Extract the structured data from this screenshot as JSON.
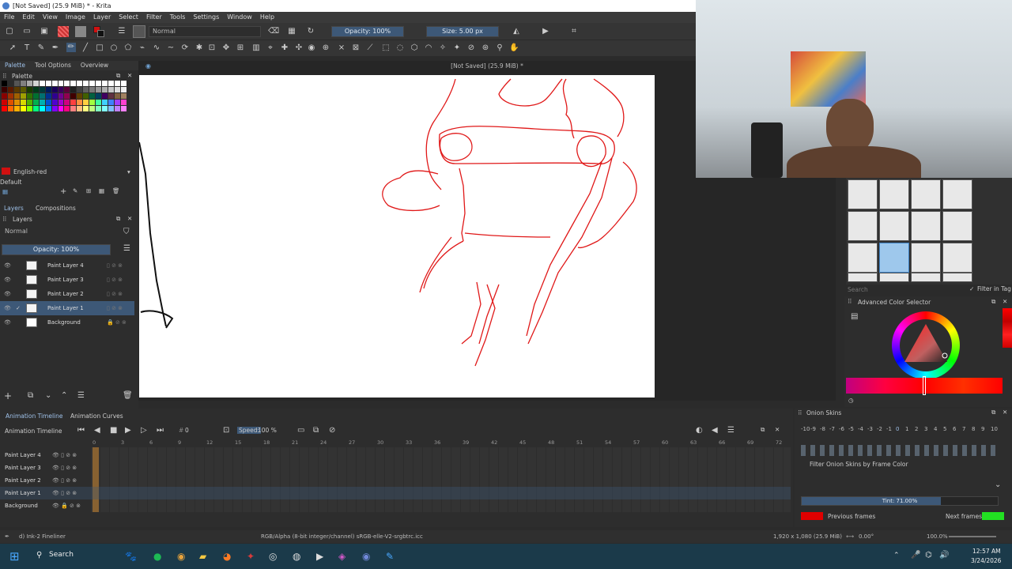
{
  "titlebar": {
    "title": "[Not Saved]  (25.9 MiB) * - Krita"
  },
  "menu": [
    "File",
    "Edit",
    "View",
    "Image",
    "Layer",
    "Select",
    "Filter",
    "Tools",
    "Settings",
    "Window",
    "Help"
  ],
  "toolbar": {
    "blend_mode": "Normal",
    "opacity": "Opacity: 100%",
    "size": "Size: 5.00 px"
  },
  "docker_tabs": [
    "Palette",
    "Tool Options",
    "Overview"
  ],
  "palette": {
    "title": "Palette",
    "current_color_name": "English-red",
    "palette_name": "Default",
    "colors": [
      "#000000",
      "#2b2b2b",
      "#555555",
      "#808080",
      "#aaaaaa",
      "#d4d4d4",
      "#ffffff",
      "#ffffff",
      "#ffffff",
      "#ffffff",
      "#ffffff",
      "#ffffff",
      "#ffffff",
      "#ffffff",
      "#ffffff",
      "#ffffff",
      "#ffffff",
      "#ffffff",
      "#ffffff",
      "#ffffff",
      "#3a0000",
      "#5a1a00",
      "#5a3a00",
      "#5a5a00",
      "#1a3a00",
      "#003a1a",
      "#003a3a",
      "#001a5a",
      "#1a005a",
      "#3a005a",
      "#5a003a",
      "#202020",
      "#404040",
      "#606060",
      "#7a7a7a",
      "#999999",
      "#b0b0b0",
      "#c8c8c8",
      "#dedede",
      "#f0f0f0",
      "#8a0000",
      "#a03000",
      "#a06000",
      "#a0a000",
      "#307000",
      "#007030",
      "#007070",
      "#003090",
      "#300090",
      "#700090",
      "#900050",
      "#400000",
      "#604000",
      "#406000",
      "#006040",
      "#004060",
      "#400060",
      "#603040",
      "#806040",
      "#a08060",
      "#d00000",
      "#e05000",
      "#e09000",
      "#d8d800",
      "#50b000",
      "#00b050",
      "#00b0b0",
      "#0050d0",
      "#5000d0",
      "#a000d0",
      "#d00080",
      "#ff4040",
      "#ff9040",
      "#ffd040",
      "#a0ff40",
      "#40ffa0",
      "#40d0ff",
      "#4080ff",
      "#a040ff",
      "#ff40d0",
      "#ff0000",
      "#ff6a00",
      "#ffb000",
      "#ffff00",
      "#80ff00",
      "#00ff80",
      "#00ffff",
      "#0080ff",
      "#8000ff",
      "#ff00ff",
      "#ff0080",
      "#ff8080",
      "#ffc080",
      "#ffff80",
      "#c0ff80",
      "#80ffc0",
      "#80ffff",
      "#80c0ff",
      "#c080ff",
      "#ff80ff"
    ]
  },
  "layers_tabs": [
    "Layers",
    "Compositions"
  ],
  "layers": {
    "title": "Layers",
    "blend_mode": "Normal",
    "opacity": "Opacity:  100%",
    "items": [
      {
        "name": "Paint Layer 4",
        "selected": false,
        "locked": false
      },
      {
        "name": "Paint Layer 3",
        "selected": false,
        "locked": false
      },
      {
        "name": "Paint Layer 2",
        "selected": false,
        "locked": false
      },
      {
        "name": "Paint Layer 1",
        "selected": true,
        "locked": false
      },
      {
        "name": "Background",
        "selected": false,
        "locked": true
      }
    ]
  },
  "canvas": {
    "doc_title": "[Not Saved]  (25.9 MiB) *"
  },
  "timeline": {
    "tabs": [
      "Animation Timeline",
      "Animation Curves"
    ],
    "title": "Animation Timeline",
    "current_frame": "0",
    "speed_label": "Speed:",
    "speed_value": "100 %",
    "frame_numbers": [
      "0",
      "3",
      "6",
      "9",
      "12",
      "15",
      "18",
      "21",
      "24",
      "27",
      "30",
      "33",
      "36",
      "39",
      "42",
      "45",
      "48",
      "51",
      "54",
      "57",
      "60",
      "63",
      "66",
      "69",
      "72"
    ],
    "layers": [
      "Paint Layer 4",
      "Paint Layer 3",
      "Paint Layer 2",
      "Paint Layer 1",
      "Background"
    ]
  },
  "onion": {
    "title": "Onion Skins",
    "numbers": [
      "-10",
      "-9",
      "-8",
      "-7",
      "-6",
      "-5",
      "-4",
      "-3",
      "-2",
      "-1",
      "0",
      "1",
      "2",
      "3",
      "4",
      "5",
      "6",
      "7",
      "8",
      "9",
      "10"
    ],
    "filter_label": "Filter Onion Skins by Frame Color",
    "tint": "Tint: 71.00%",
    "tint_value": 0.71,
    "previous_label": "Previous frames",
    "next_label": "Next frames",
    "previous_color": "#e00000",
    "next_color": "#22e022"
  },
  "brush_presets": {
    "filter_label": "Filter in Tag",
    "search_placeholder": "Search"
  },
  "color_selector": {
    "title": "Advanced Color Selector"
  },
  "status": {
    "brush": "d) Ink-2 Fineliner",
    "color_info": "RGB/Alpha (8-bit integer/channel)  sRGB-elle-V2-srgbtrc.icc",
    "dims": "1,920 x 1,080 (25.9 MiB)",
    "rotation": "0.00°",
    "zoom": "100.0%"
  },
  "taskbar": {
    "search_label": "Search",
    "time": "12:57 AM",
    "date": "3/24/2026"
  },
  "colors": {
    "accent": "#3d5877",
    "stroke": "#e02020"
  }
}
